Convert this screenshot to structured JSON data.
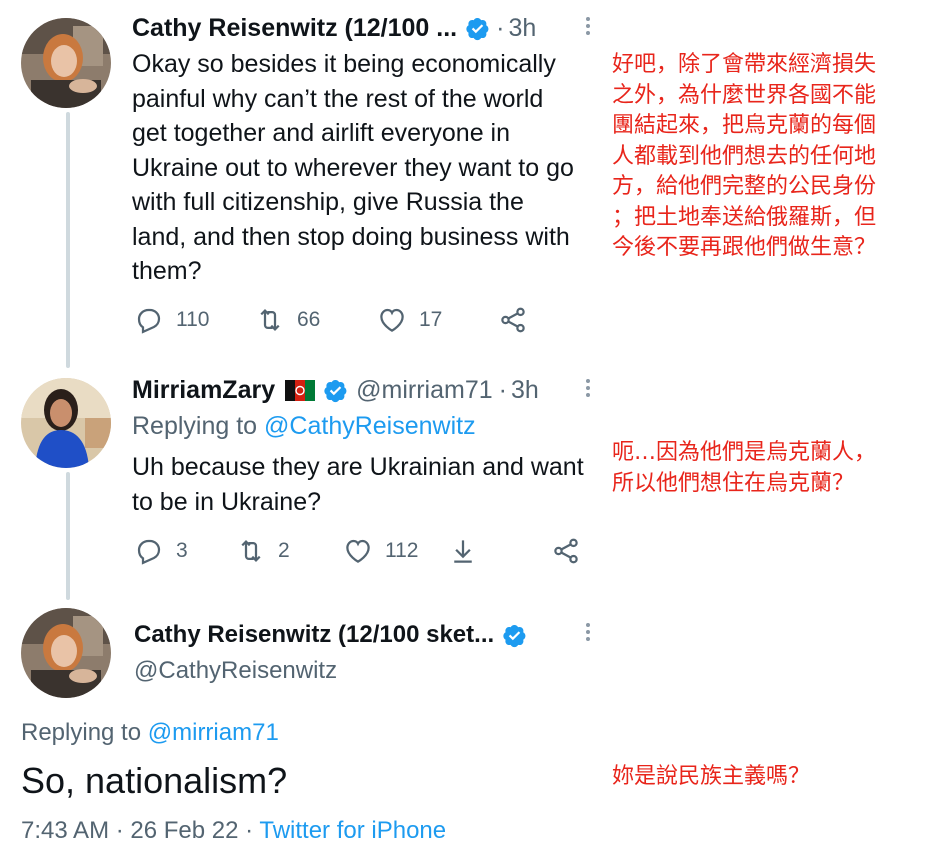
{
  "tweets": [
    {
      "name": "Cathy Reisenwitz (12/100 ...",
      "time": "3h",
      "text": "Okay so besides it being economically painful why can’t the rest of the world get together and airlift everyone in Ukraine out to wherever they want to go with full citizenship, give Russia the land, and then stop doing business with them?",
      "lines": [
        "Okay so besides it being economically",
        "painful why can’t the rest of the world",
        "get together and airlift everyone in",
        "Ukraine out to wherever they want to go",
        "with full citizenship, give Russia the",
        "land, and then stop doing business with",
        "them?"
      ],
      "replies": "110",
      "retweets": "66",
      "likes": "17",
      "translation": [
        "好吧，除了會帶來經濟損失",
        "之外，為什麼世界各國不能",
        "團結起來，把烏克蘭的每個",
        "人都載到他們想去的任何地",
        "方，給他們完整的公民身份",
        "；把土地奉送給俄羅斯，但",
        "今後不要再跟他們做生意？"
      ]
    },
    {
      "name": "MirriamZary",
      "handle": "@mirriam71",
      "time": "3h",
      "replying_label": "Replying to",
      "replying_to": "@CathyReisenwitz",
      "lines": [
        "Uh because they are Ukrainian and want",
        "to be in Ukraine?"
      ],
      "replies": "3",
      "retweets": "2",
      "likes": "112",
      "translation": [
        "呃…因為他們是烏克蘭人，",
        "所以他們想住在烏克蘭？"
      ]
    },
    {
      "name": "Cathy Reisenwitz (12/100 sket...",
      "handle": "@CathyReisenwitz",
      "replying_label": "Replying to",
      "replying_to": "@mirriam71",
      "text": "So, nationalism?",
      "date": "7:43 AM · 26 Feb 22 ·",
      "source": "Twitter for iPhone",
      "translation": "妳是說民族主義嗎？"
    }
  ],
  "colors": {
    "text": "#0f1419",
    "muted": "#536471",
    "link": "#1d9bf0",
    "verified": "#1d9bf0",
    "translation": "#e8251b",
    "thread_line": "#cfd9de"
  },
  "icons": [
    "verified-badge-icon",
    "afghanistan-flag-icon",
    "more-icon",
    "reply-icon",
    "retweet-icon",
    "like-icon",
    "share-icon",
    "download-icon"
  ]
}
